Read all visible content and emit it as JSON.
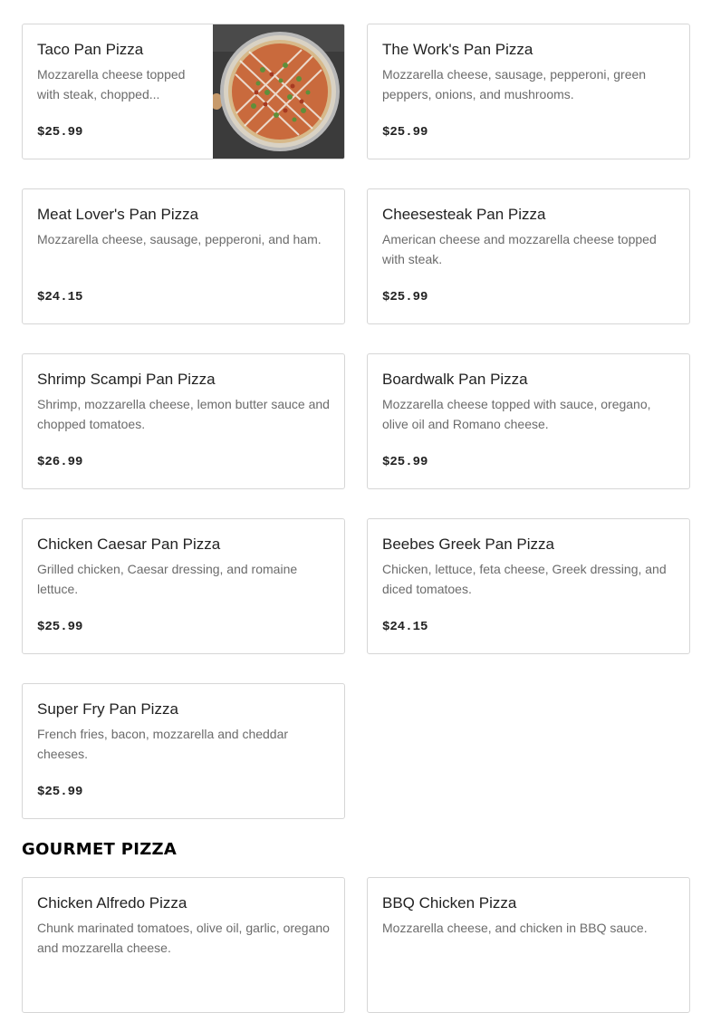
{
  "pan_pizza": {
    "items": [
      {
        "name": "Taco Pan Pizza",
        "description": "Mozzarella cheese topped with steak, chopped...",
        "price": "$25.99"
      },
      {
        "name": "The Work's Pan Pizza",
        "description": "Mozzarella cheese, sausage, pepperoni, green peppers, onions, and mushrooms.",
        "price": "$25.99"
      },
      {
        "name": "Meat Lover's Pan Pizza",
        "description": "Mozzarella cheese, sausage, pepperoni, and ham.",
        "price": "$24.15"
      },
      {
        "name": "Cheesesteak Pan Pizza",
        "description": "American cheese and mozzarella cheese topped with steak.",
        "price": "$25.99"
      },
      {
        "name": "Shrimp Scampi Pan Pizza",
        "description": "Shrimp, mozzarella cheese, lemon butter sauce and chopped tomatoes.",
        "price": "$26.99"
      },
      {
        "name": "Boardwalk Pan Pizza",
        "description": "Mozzarella cheese topped with sauce, oregano, olive oil and Romano cheese.",
        "price": "$25.99"
      },
      {
        "name": "Chicken Caesar Pan Pizza",
        "description": "Grilled chicken, Caesar dressing, and romaine lettuce.",
        "price": "$25.99"
      },
      {
        "name": "Beebes Greek Pan Pizza",
        "description": "Chicken, lettuce, feta cheese, Greek dressing, and diced tomatoes.",
        "price": "$24.15"
      },
      {
        "name": "Super Fry Pan Pizza",
        "description": "French fries, bacon, mozzarella and cheddar cheeses.",
        "price": "$25.99"
      }
    ]
  },
  "gourmet_pizza": {
    "heading": "GOURMET PIZZA",
    "items": [
      {
        "name": "Chicken Alfredo Pizza",
        "description": "Chunk marinated tomatoes, olive oil, garlic, oregano and mozzarella cheese."
      },
      {
        "name": "BBQ Chicken Pizza",
        "description": "Mozzarella cheese, and chicken in BBQ sauce."
      }
    ]
  },
  "colors": {
    "card_border": "#d6d6d6",
    "description_text": "#6b6b6b",
    "heading_text": "#000000"
  }
}
